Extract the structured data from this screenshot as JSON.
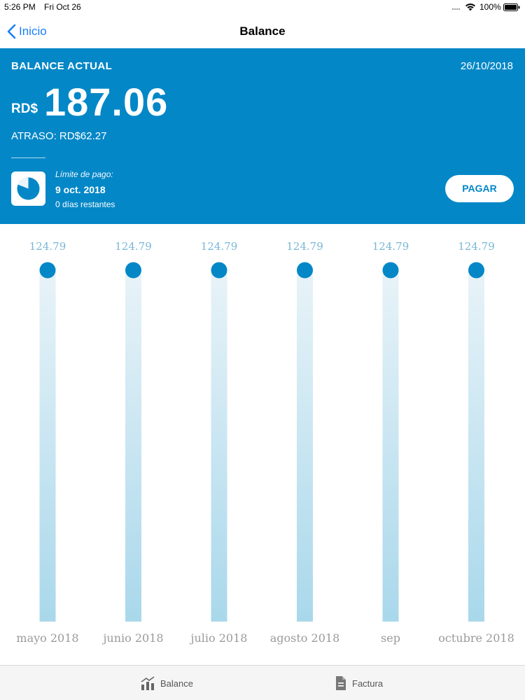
{
  "status_bar": {
    "time": "5:26 PM",
    "date": "Fri Oct 26",
    "battery": "100%"
  },
  "nav": {
    "back_label": "Inicio",
    "title": "Balance"
  },
  "balance": {
    "label": "BALANCE ACTUAL",
    "date": "26/10/2018",
    "currency": "RD$",
    "amount": "187.06",
    "overdue": "ATRASO: RD$62.27",
    "deadline_title": "Límite de pago:",
    "deadline_date": "9 oct. 2018",
    "days_left": "0 días restantes",
    "pay_label": "PAGAR",
    "accent_color": "#0387c7"
  },
  "chart_data": {
    "type": "bar",
    "categories": [
      "mayo 2018",
      "junio 2018",
      "julio 2018",
      "agosto 2018",
      "sep",
      "octubre 2018"
    ],
    "values": [
      124.79,
      124.79,
      124.79,
      124.79,
      124.79,
      124.79
    ],
    "value_labels": [
      "124.79",
      "124.79",
      "124.79",
      "124.79",
      "124.79",
      "124.79"
    ],
    "ylim": [
      0,
      124.79
    ],
    "grid": false,
    "colors": {
      "marker": "#0387c7",
      "bar_top": "#e8f3f8",
      "bar_bottom": "#a9d8eb",
      "label": "#7ab7d6",
      "category": "#9a9a9a"
    }
  },
  "tabs": [
    {
      "label": "Balance",
      "icon": "bar-chart-icon"
    },
    {
      "label": "Factura",
      "icon": "document-icon"
    }
  ]
}
